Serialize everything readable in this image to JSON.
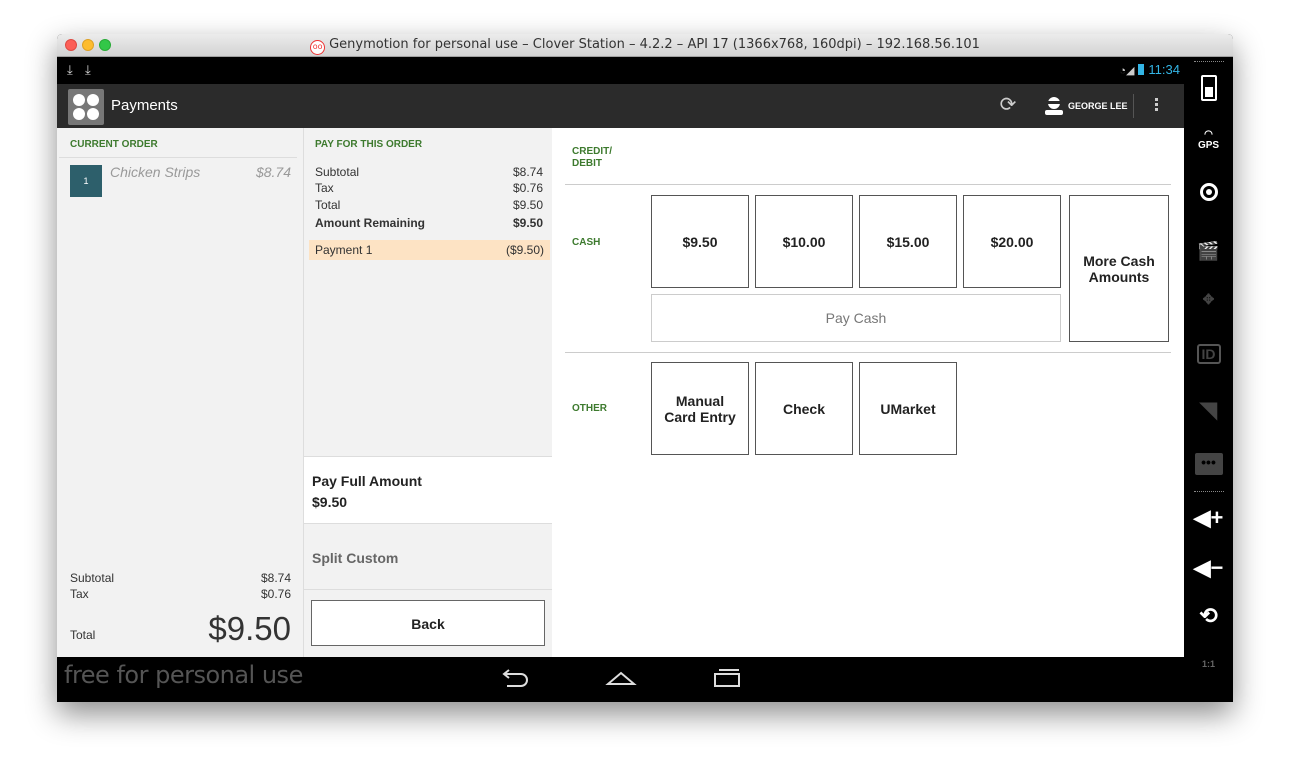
{
  "window": {
    "title": "Genymotion for personal use – Clover Station – 4.2.2 – API 17 (1366x768, 160dpi) – 192.168.56.101"
  },
  "statusbar": {
    "time": "11:34"
  },
  "appbar": {
    "title": "Payments",
    "user_name": "GEORGE LEE"
  },
  "current_order": {
    "heading": "CURRENT ORDER",
    "items": [
      {
        "qty": "1",
        "name": "Chicken Strips",
        "price": "$8.74"
      }
    ],
    "subtotal_label": "Subtotal",
    "subtotal_value": "$8.74",
    "tax_label": "Tax",
    "tax_value": "$0.76",
    "total_label": "Total",
    "total_value": "$9.50"
  },
  "pay_order": {
    "heading": "PAY FOR THIS ORDER",
    "rows": [
      {
        "label": "Subtotal",
        "value": "$8.74"
      },
      {
        "label": "Tax",
        "value": "$0.76"
      },
      {
        "label": "Total",
        "value": "$9.50"
      },
      {
        "label": "Amount Remaining",
        "value": "$9.50"
      }
    ],
    "payment": {
      "label": "Payment 1",
      "value": "($9.50)"
    },
    "pay_full_label": "Pay Full Amount",
    "pay_full_amount": "$9.50",
    "split_label": "Split Custom",
    "back_label": "Back"
  },
  "tenders": {
    "credit_label_1": "CREDIT/",
    "credit_label_2": "DEBIT",
    "cash_label": "CASH",
    "cash_amounts": [
      "$9.50",
      "$10.00",
      "$15.00",
      "$20.00"
    ],
    "more_cash_1": "More Cash",
    "more_cash_2": "Amounts",
    "pay_cash_label": "Pay Cash",
    "other_label": "OTHER",
    "manual_card_1": "Manual",
    "manual_card_2": "Card Entry",
    "check_label": "Check",
    "umarket_label": "UMarket"
  },
  "navbar": {
    "watermark": "free for personal use"
  },
  "sidebar": {
    "gps_label": "GPS",
    "id_label": "ID",
    "scale_label": "1:1"
  }
}
